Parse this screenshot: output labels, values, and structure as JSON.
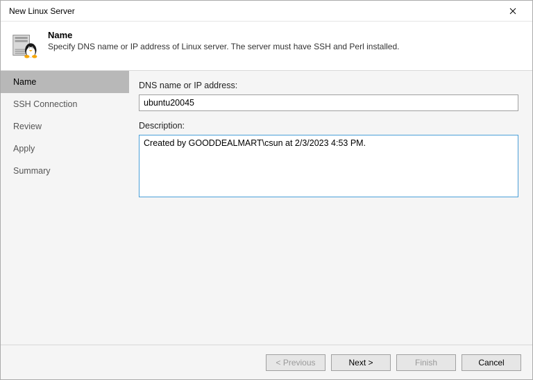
{
  "window": {
    "title": "New Linux Server"
  },
  "header": {
    "title": "Name",
    "subtitle": "Specify DNS name or IP address of Linux server. The server must have SSH and Perl installed."
  },
  "sidebar": {
    "items": [
      {
        "label": "Name",
        "active": true
      },
      {
        "label": "SSH Connection",
        "active": false
      },
      {
        "label": "Review",
        "active": false
      },
      {
        "label": "Apply",
        "active": false
      },
      {
        "label": "Summary",
        "active": false
      }
    ]
  },
  "form": {
    "dns_label": "DNS name or IP address:",
    "dns_value": "ubuntu20045",
    "desc_label": "Description:",
    "desc_value": "Created by GOODDEALMART\\csun at 2/3/2023 4:53 PM."
  },
  "buttons": {
    "previous": "< Previous",
    "next": "Next >",
    "finish": "Finish",
    "cancel": "Cancel"
  }
}
